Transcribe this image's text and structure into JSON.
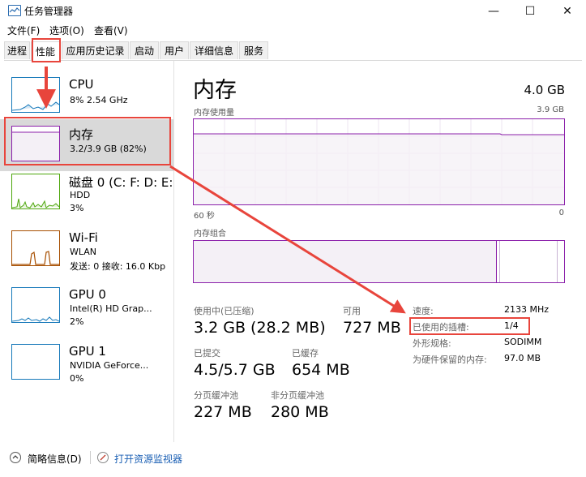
{
  "window": {
    "title": "任务管理器",
    "minimize": "—",
    "maximize": "☐",
    "close": "✕"
  },
  "menu": {
    "file": "文件(F)",
    "options": "选项(O)",
    "view": "查看(V)"
  },
  "tabs": [
    "进程",
    "性能",
    "应用历史记录",
    "启动",
    "用户",
    "详细信息",
    "服务"
  ],
  "sidebar": {
    "items": [
      {
        "name": "CPU",
        "sub1": "8% 2.54 GHz",
        "sub2": "",
        "sub3": ""
      },
      {
        "name": "内存",
        "sub1": "3.2/3.9 GB (82%)",
        "sub2": "",
        "sub3": ""
      },
      {
        "name": "磁盘 0 (C: F: D: E:",
        "sub1": "HDD",
        "sub2": "3%",
        "sub3": ""
      },
      {
        "name": "Wi-Fi",
        "sub1": "WLAN",
        "sub2": "发送: 0 接收: 16.0 Kbp",
        "sub3": ""
      },
      {
        "name": "GPU 0",
        "sub1": "Intel(R) HD Grap...",
        "sub2": "2%",
        "sub3": ""
      },
      {
        "name": "GPU 1",
        "sub1": "NVIDIA GeForce...",
        "sub2": "0%",
        "sub3": ""
      }
    ]
  },
  "main": {
    "title": "内存",
    "total": "4.0 GB",
    "usage_graph_label": "内存使用量",
    "usage_graph_max": "3.9 GB",
    "time_span": "60 秒",
    "time_end": "0",
    "composition_label": "内存组合",
    "stats": {
      "in_use_label": "使用中(已压缩)",
      "in_use_value": "3.2 GB (28.2 MB)",
      "available_label": "可用",
      "available_value": "727 MB",
      "committed_label": "已提交",
      "committed_value": "4.5/5.7 GB",
      "cached_label": "已缓存",
      "cached_value": "654 MB",
      "paged_label": "分页缓冲池",
      "paged_value": "227 MB",
      "nonpaged_label": "非分页缓冲池",
      "nonpaged_value": "280 MB"
    },
    "props": {
      "speed_label": "速度:",
      "speed_value": "2133 MHz",
      "slots_label": "已使用的插槽:",
      "slots_value": "1/4",
      "form_label": "外形规格:",
      "form_value": "SODIMM",
      "reserved_label": "为硬件保留的内存:",
      "reserved_value": "97.0 MB"
    }
  },
  "footer": {
    "fewer_details": "简略信息(D)",
    "resource_monitor": "打开资源监视器"
  },
  "colors": {
    "memory": "#8b1faa",
    "memory_fill": "#f4f0f6",
    "cpu": "#1779ba",
    "disk": "#4da60c",
    "wifi": "#a74f01",
    "annotation": "#e8453c"
  }
}
